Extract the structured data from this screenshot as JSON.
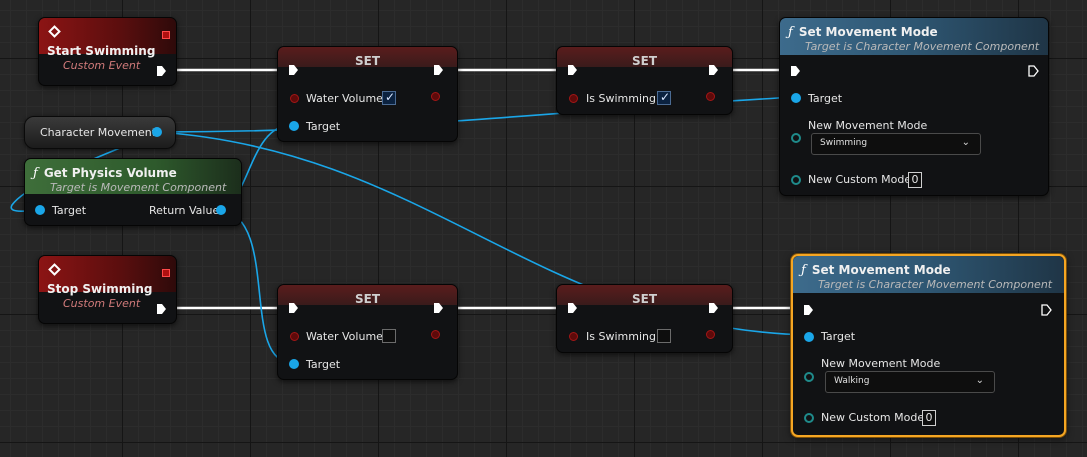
{
  "graph": {
    "nodes": {
      "start_swimming": {
        "title": "Start Swimming",
        "subtitle": "Custom Event"
      },
      "stop_swimming": {
        "title": "Stop Swimming",
        "subtitle": "Custom Event"
      },
      "character_movement": {
        "label": "Character Movement"
      },
      "get_physics_volume": {
        "title": "Get Physics Volume",
        "subtitle": "Target is Movement Component",
        "target_label": "Target",
        "return_label": "Return Value"
      },
      "set_water_volume_1": {
        "title": "SET",
        "pin_label": "Water Volume",
        "checked": true,
        "target_label": "Target"
      },
      "set_is_swimming_1": {
        "title": "SET",
        "pin_label": "Is Swimming",
        "checked": true
      },
      "set_water_volume_2": {
        "title": "SET",
        "pin_label": "Water Volume",
        "checked": false,
        "target_label": "Target"
      },
      "set_is_swimming_2": {
        "title": "SET",
        "pin_label": "Is Swimming",
        "checked": false
      },
      "set_movement_mode_1": {
        "title": "Set Movement Mode",
        "subtitle": "Target is Character Movement Component",
        "target_label": "Target",
        "mode_label": "New Movement Mode",
        "mode_value": "Swimming",
        "custom_label": "New Custom Mode",
        "custom_value": "0"
      },
      "set_movement_mode_2": {
        "title": "Set Movement Mode",
        "subtitle": "Target is Character Movement Component",
        "target_label": "Target",
        "mode_label": "New Movement Mode",
        "mode_value": "Walking",
        "custom_label": "New Custom Mode",
        "custom_value": "0"
      }
    },
    "icons": {
      "event": "event-diamond-icon",
      "function": "function-f-icon",
      "exec": "exec-arrow-icon"
    },
    "colors": {
      "exec_wire": "#ffffff",
      "object_wire": "#1aa6e8",
      "selection": "#f5a623"
    }
  }
}
